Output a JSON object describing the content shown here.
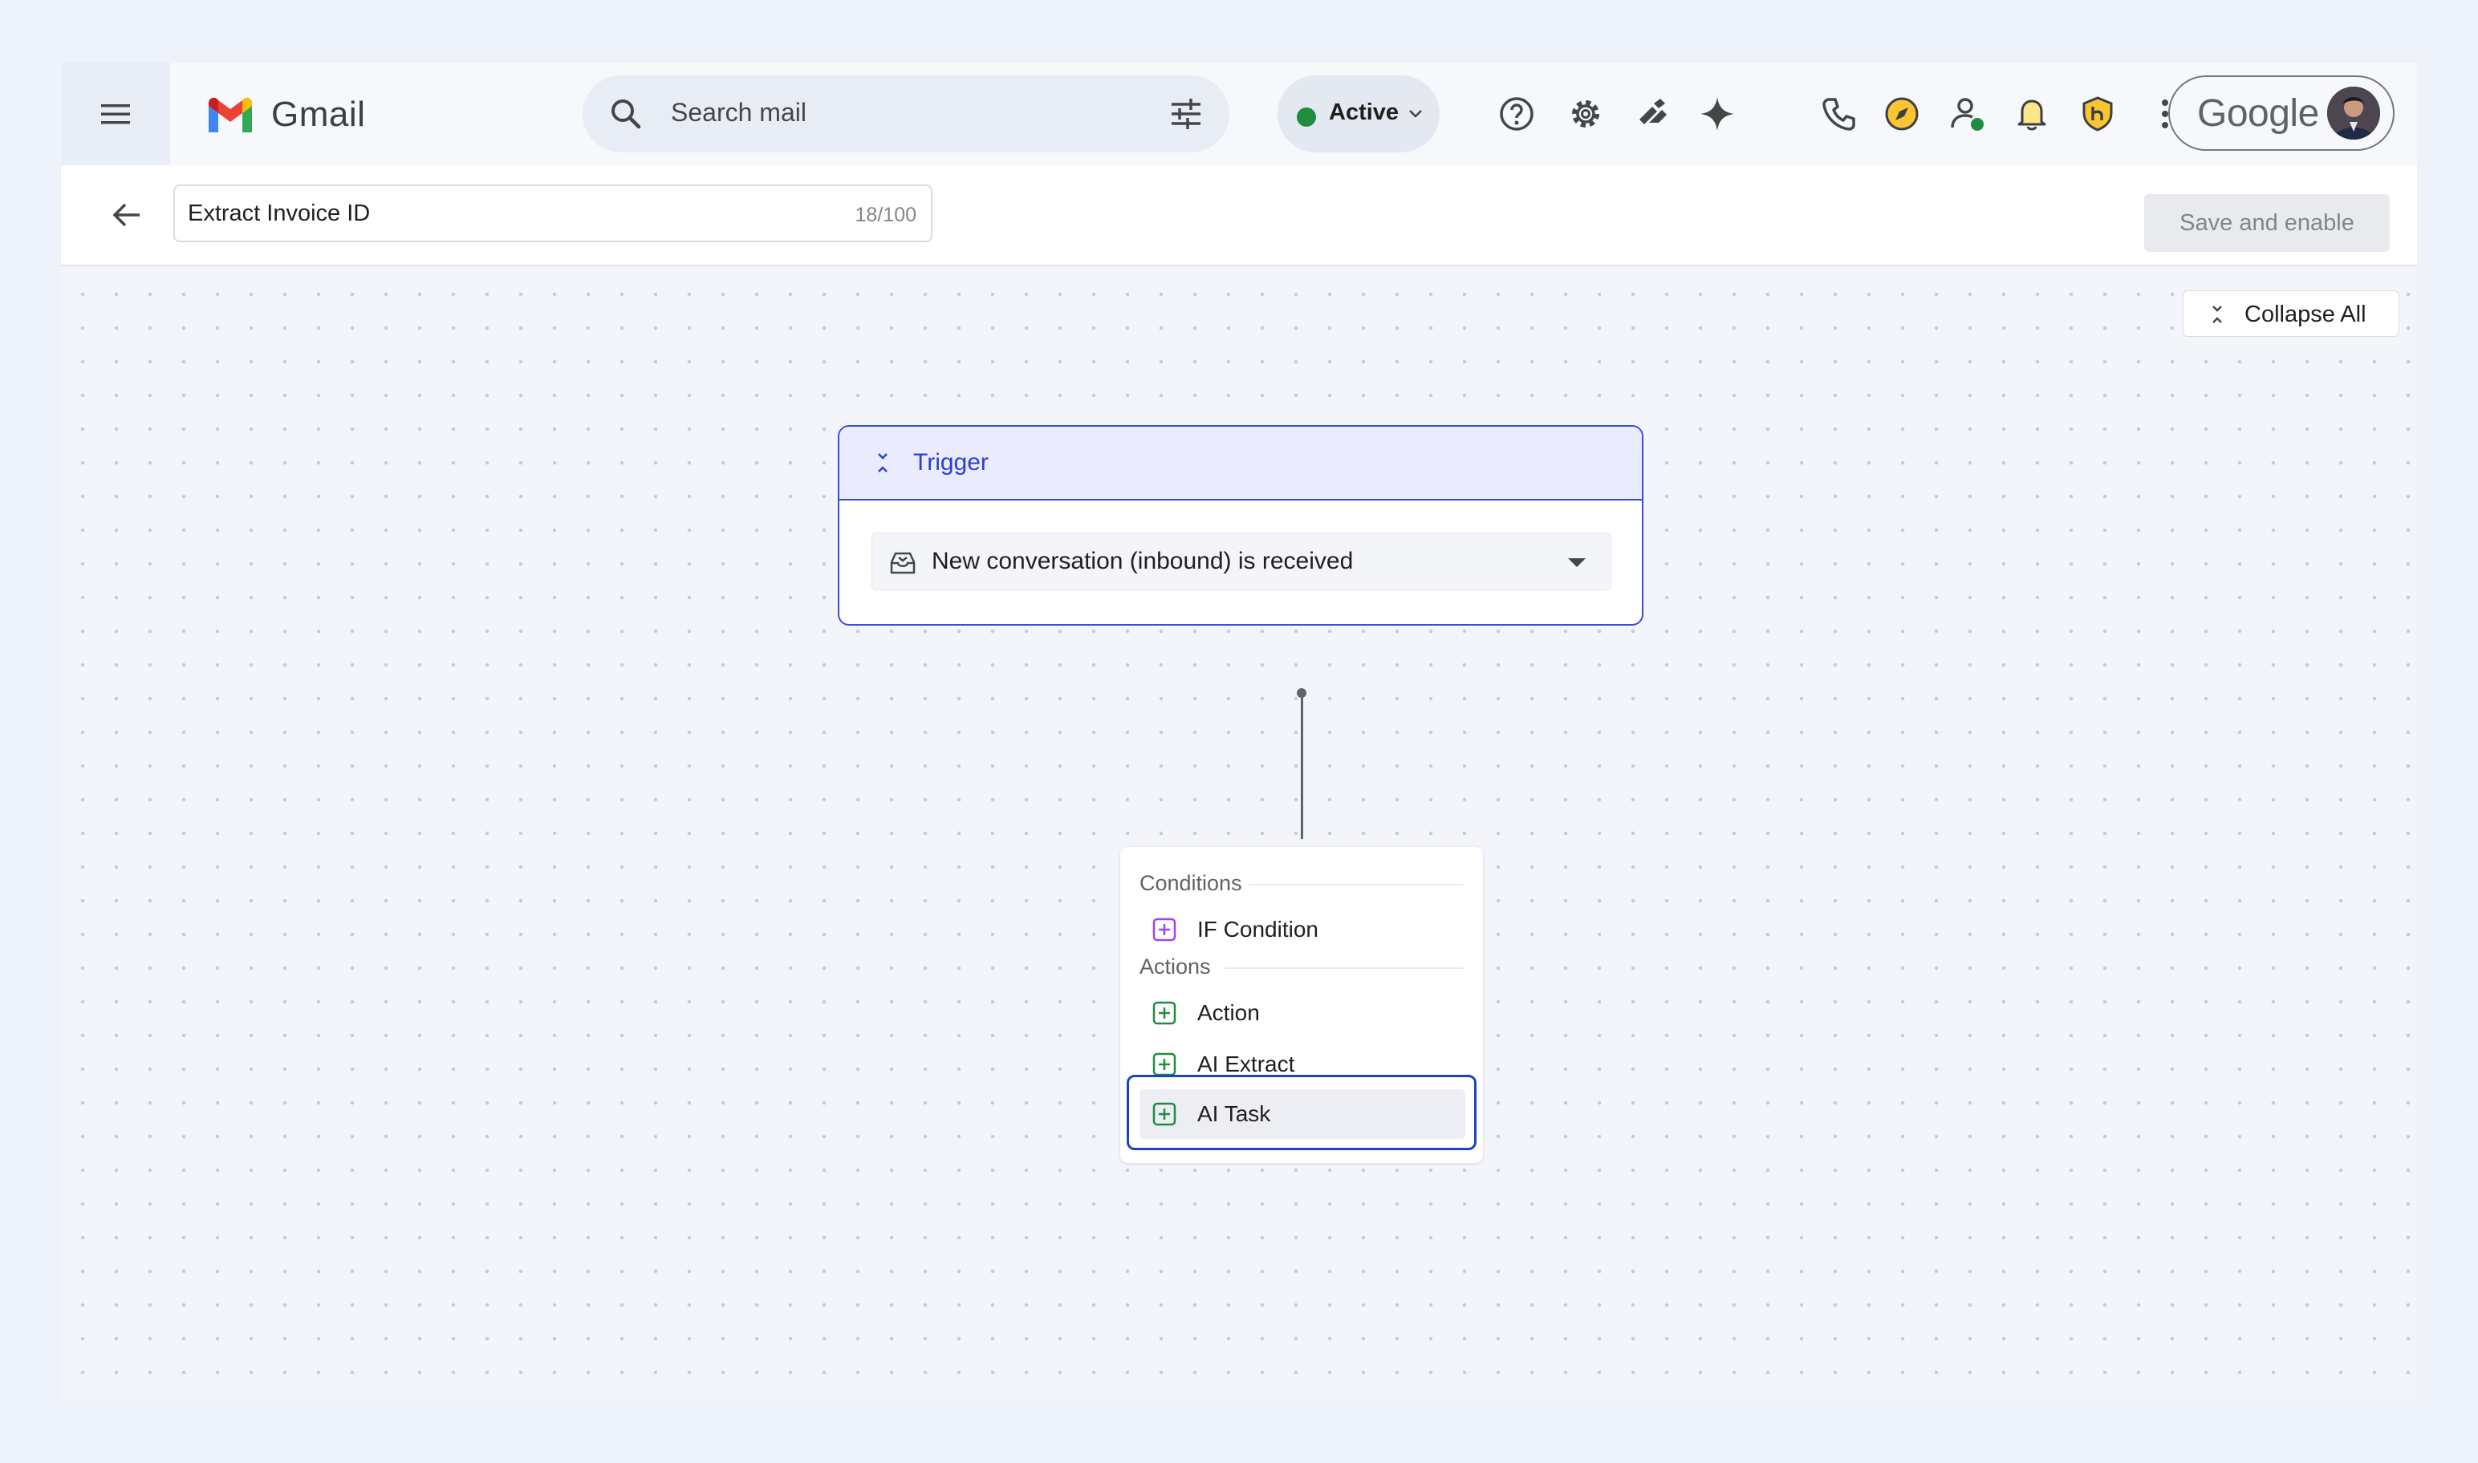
{
  "app": {
    "name": "Gmail"
  },
  "search": {
    "placeholder": "Search mail"
  },
  "status": {
    "label": "Active",
    "color": "#1e8e3e"
  },
  "header_icons": [
    "help-icon",
    "settings-icon",
    "apps-script-icon",
    "gemini-sparkle-icon",
    "phone-icon",
    "compass-icon",
    "contact-status-icon",
    "bell-icon",
    "shield-extension-icon",
    "google-apps-grid-icon"
  ],
  "account": {
    "brand": "Google"
  },
  "workflow": {
    "name": "Extract Invoice ID",
    "char_count": "18/100",
    "save_label": "Save and enable"
  },
  "canvas": {
    "collapse_label": "Collapse All",
    "trigger": {
      "title": "Trigger",
      "selected": "New conversation (inbound) is received"
    },
    "add_menu": {
      "conditions_label": "Conditions",
      "conditions": [
        "IF Condition"
      ],
      "actions_label": "Actions",
      "actions": [
        "Action",
        "AI Extract",
        "AI Task"
      ],
      "highlighted": "AI Task"
    }
  },
  "colors": {
    "accent": "#3b4bdc",
    "condition_plus": "#a142f4",
    "action_plus": "#1e8e3e",
    "selection": "#1846c2"
  }
}
